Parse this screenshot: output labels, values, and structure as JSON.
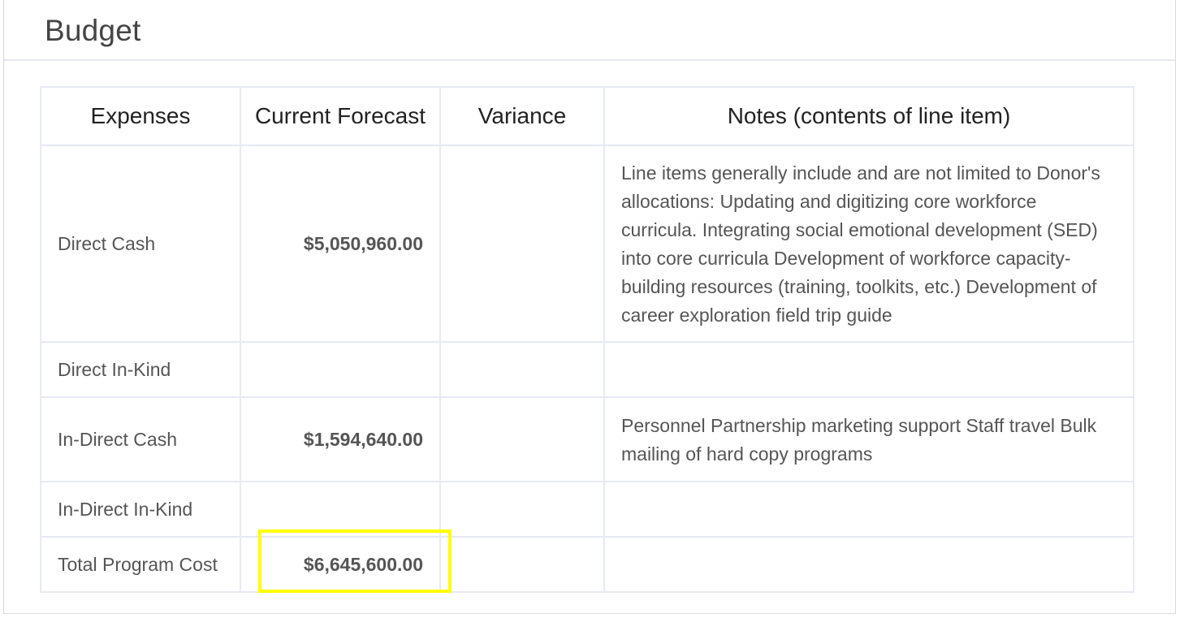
{
  "panel": {
    "title": "Budget"
  },
  "table": {
    "headers": {
      "expenses": "Expenses",
      "forecast": "Current Forecast",
      "variance": "Variance",
      "notes": "Notes (contents of line item)"
    },
    "rows": [
      {
        "expense": "Direct Cash",
        "forecast": "$5,050,960.00",
        "variance": "",
        "notes": "Line items generally include and are not limited to Donor's allocations: Updating and digitizing core workforce curricula. Integrating social emotional development (SED) into core curricula Development of workforce capacity-building resources (training, toolkits, etc.) Development of career exploration field trip guide"
      },
      {
        "expense": "Direct In-Kind",
        "forecast": "",
        "variance": "",
        "notes": ""
      },
      {
        "expense": "In-Direct Cash",
        "forecast": "$1,594,640.00",
        "variance": "",
        "notes": "Personnel Partnership marketing support Staff travel Bulk mailing of hard copy programs"
      },
      {
        "expense": "In-Direct In-Kind",
        "forecast": "",
        "variance": "",
        "notes": ""
      },
      {
        "expense": "Total Program Cost",
        "forecast": "$6,645,600.00",
        "variance": "",
        "notes": ""
      }
    ]
  },
  "colors": {
    "highlight": "#ffff00",
    "border": "#e7e9f3"
  }
}
